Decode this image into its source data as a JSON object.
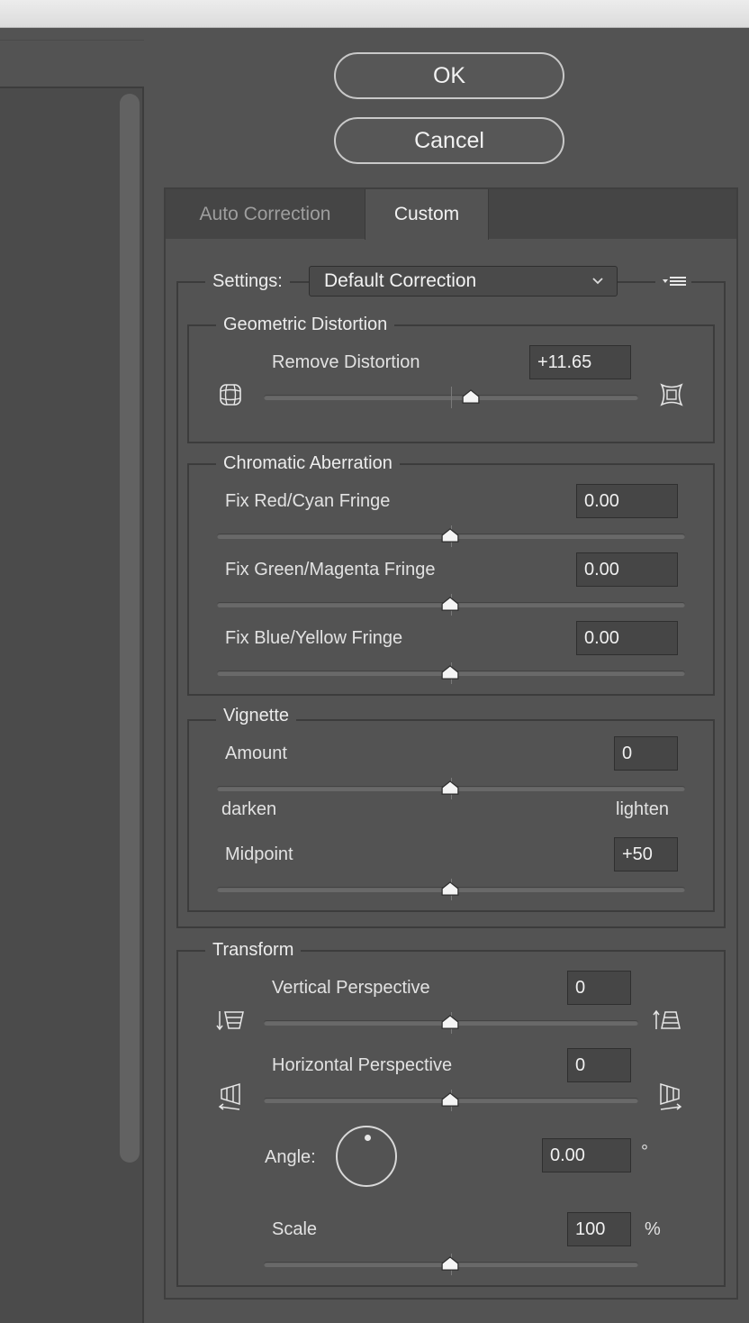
{
  "buttons": {
    "ok": "OK",
    "cancel": "Cancel"
  },
  "tabs": [
    {
      "label": "Auto Correction",
      "active": false
    },
    {
      "label": "Custom",
      "active": true
    }
  ],
  "settings": {
    "label": "Settings:",
    "value": "Default Correction",
    "menu_icon": "flyout-menu-icon"
  },
  "geometric": {
    "title": "Geometric Distortion",
    "remove": {
      "label": "Remove Distortion",
      "value": "+11.65",
      "slider_fraction": 0.555
    },
    "left_icon": "pincushion-distortion-icon",
    "right_icon": "barrel-distortion-icon"
  },
  "chromatic": {
    "title": "Chromatic Aberration",
    "red_cyan": {
      "label": "Fix Red/Cyan Fringe",
      "value": "0.00",
      "slider_fraction": 0.5
    },
    "green_magenta": {
      "label": "Fix Green/Magenta Fringe",
      "value": "0.00",
      "slider_fraction": 0.5
    },
    "blue_yellow": {
      "label": "Fix Blue/Yellow Fringe",
      "value": "0.00",
      "slider_fraction": 0.5
    }
  },
  "vignette": {
    "title": "Vignette",
    "amount": {
      "label": "Amount",
      "value": "0",
      "slider_fraction": 0.5
    },
    "darken_label": "darken",
    "lighten_label": "lighten",
    "midpoint": {
      "label": "Midpoint",
      "value": "+50",
      "slider_fraction": 0.5
    }
  },
  "transform": {
    "title": "Transform",
    "vertical": {
      "label": "Vertical Perspective",
      "value": "0",
      "slider_fraction": 0.5
    },
    "horizontal": {
      "label": "Horizontal Perspective",
      "value": "0",
      "slider_fraction": 0.5
    },
    "angle": {
      "label": "Angle:",
      "value": "0.00",
      "unit": "°"
    },
    "scale": {
      "label": "Scale",
      "value": "100",
      "unit": "%",
      "slider_fraction": 0.5
    }
  }
}
